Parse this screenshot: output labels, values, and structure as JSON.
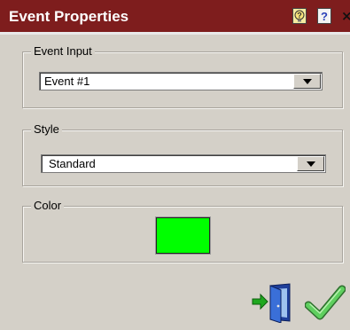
{
  "window": {
    "title": "Event Properties",
    "help_context_icon": "context-help-icon",
    "help_icon": "help-icon",
    "help_label": "?",
    "close_label": "×"
  },
  "event_input": {
    "legend": "Event Input",
    "selected": "Event #1"
  },
  "style": {
    "legend": "Style",
    "selected": "Standard"
  },
  "color": {
    "legend": "Color",
    "value": "#00ff00"
  },
  "actions": {
    "exit_icon": "exit-door-icon",
    "ok_icon": "checkmark-icon"
  }
}
